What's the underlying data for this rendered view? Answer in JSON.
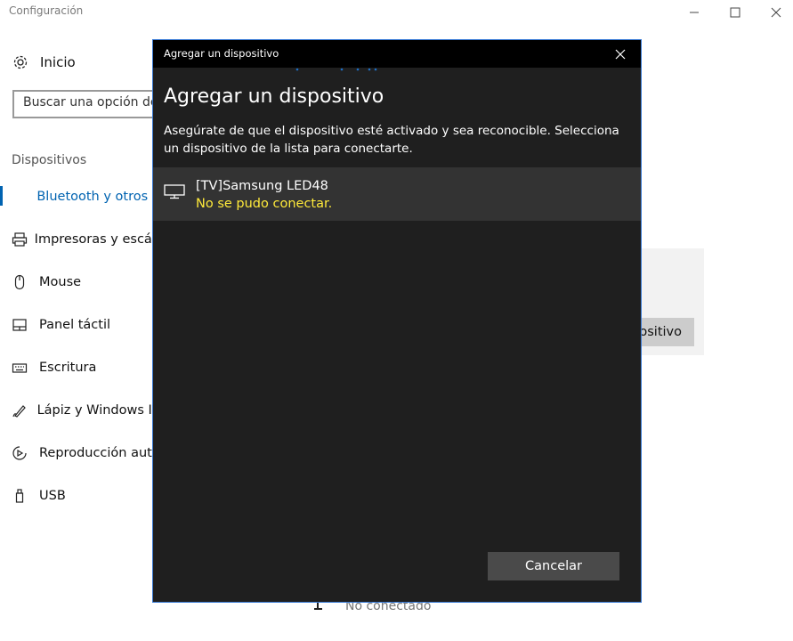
{
  "window": {
    "title": "Configuración",
    "controls": [
      "minimize-icon",
      "maximize-icon",
      "close-icon"
    ]
  },
  "sidebar": {
    "home_label": "Inicio",
    "search_placeholder": "Buscar una opción de",
    "section_title": "Dispositivos",
    "items": [
      {
        "label": "Bluetooth y otros d",
        "icon": "bluetooth-devices-icon",
        "active": true
      },
      {
        "label": "Impresoras y escán",
        "icon": "printer-icon",
        "active": false
      },
      {
        "label": "Mouse",
        "icon": "mouse-icon",
        "active": false
      },
      {
        "label": "Panel táctil",
        "icon": "touchpad-icon",
        "active": false
      },
      {
        "label": "Escritura",
        "icon": "keyboard-icon",
        "active": false
      },
      {
        "label": "Lápiz y Windows In",
        "icon": "pen-icon",
        "active": false
      },
      {
        "label": "Reproducción auto",
        "icon": "autoplay-icon",
        "active": false
      },
      {
        "label": "USB",
        "icon": "usb-icon",
        "active": false
      }
    ]
  },
  "main": {
    "add_button_partial": "ositivo",
    "bottom_status": "No conectado"
  },
  "dialog": {
    "titlebar": "Agregar un dispositivo",
    "heading": "Agregar un dispositivo",
    "description": "Asegúrate de que el dispositivo esté activado y sea reconocible. Selecciona un dispositivo de la lista para conectarte.",
    "devices": [
      {
        "name": "[TV]Samsung LED48",
        "status": "No se pudo conectar.",
        "icon": "monitor-icon"
      }
    ],
    "cancel_label": "Cancelar"
  },
  "colors": {
    "accent": "#0063b1",
    "dialog_bg": "#1f1f1f",
    "error_status": "#ffea3a",
    "dialog_border": "#3a7bd5"
  }
}
